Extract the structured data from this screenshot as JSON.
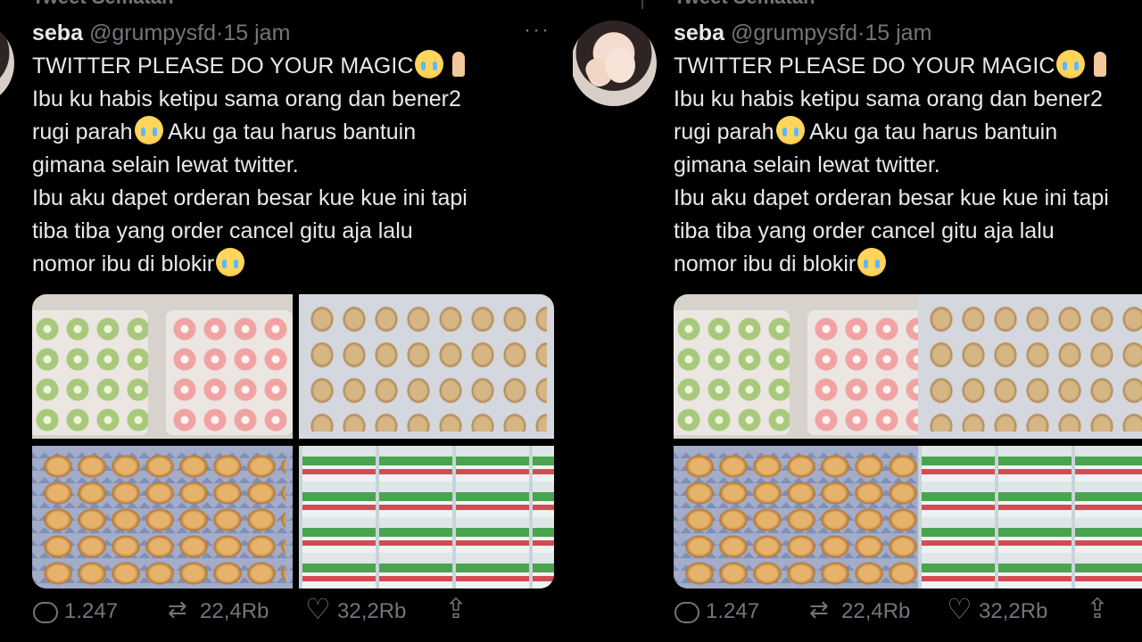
{
  "section_header": "Tweet Sematan",
  "tweet": {
    "name": "seba",
    "handle": "@grumpysfd",
    "separator": "·",
    "time": "15 jam",
    "more": "···",
    "line1": "TWITTER PLEASE DO YOUR MAGIC",
    "line2": "Ibu ku habis ketipu sama orang dan bener2",
    "line3": "rugi parah",
    "line3b": " Aku ga tau harus bantuin",
    "line4": "gimana selain lewat twitter.",
    "line5": "Ibu aku dapet orderan besar kue kue ini tapi",
    "line6": "tiba tiba yang order cancel gitu aja lalu",
    "line7": "nomor ibu di blokir",
    "replies": "1.247",
    "retweets": "22,4Rb",
    "likes": "32,2Rb"
  },
  "icons": {
    "reply": "reply-icon",
    "retweet": "retweet-icon",
    "like": "heart-icon",
    "share": "share-icon",
    "more": "more-icon"
  },
  "colors": {
    "background": "#000000",
    "text": "#e7e9ea",
    "muted": "#71767b"
  }
}
